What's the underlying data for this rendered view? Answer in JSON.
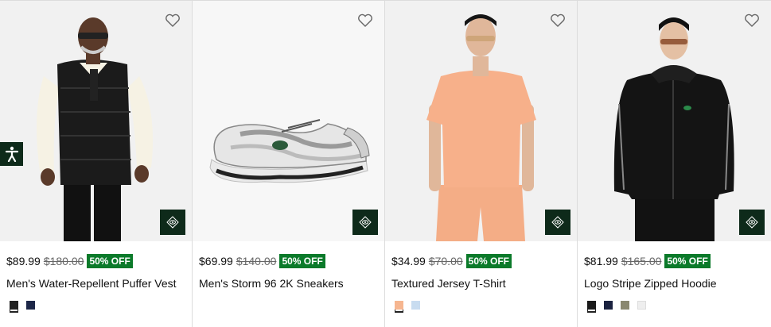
{
  "products": [
    {
      "name": "Men's Water-Repellent Puffer Vest",
      "price": "$89.99",
      "old_price": "$180.00",
      "badge": "50% OFF",
      "swatches": [
        "#222222",
        "#1d2748"
      ]
    },
    {
      "name": "Men's Storm 96 2K Sneakers",
      "price": "$69.99",
      "old_price": "$140.00",
      "badge": "50% OFF",
      "swatches": []
    },
    {
      "name": "Textured Jersey T-Shirt",
      "price": "$34.99",
      "old_price": "$70.00",
      "badge": "50% OFF",
      "swatches": [
        "#f6b690",
        "#c8dcf0"
      ]
    },
    {
      "name": "Logo Stripe Zipped Hoodie",
      "price": "$81.99",
      "old_price": "$165.00",
      "badge": "50% OFF",
      "swatches": [
        "#1a1a1a",
        "#1b2240",
        "#8a8870",
        "#eeeeee"
      ]
    }
  ],
  "colors": {
    "badge_bg": "#0b7a2a",
    "quick_view_bg": "#0e2a1a",
    "accessibility_bg": "#0e2a1a"
  },
  "icons": {
    "wishlist": "heart-outline-icon",
    "quick_view": "eye-diamond-icon",
    "accessibility": "accessibility-person-icon"
  }
}
